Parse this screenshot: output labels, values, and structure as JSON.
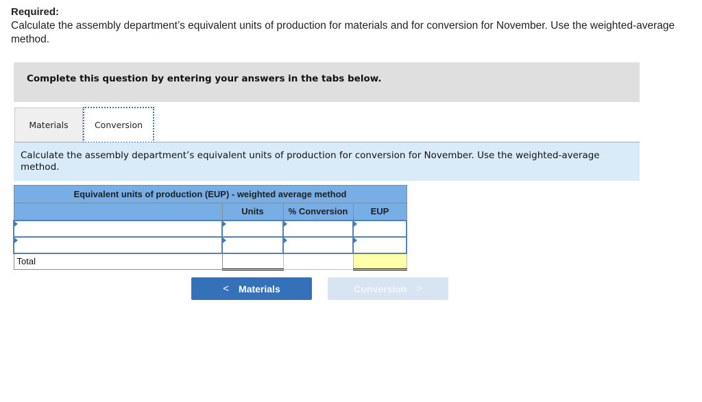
{
  "required": {
    "title": "Required:",
    "text": "Calculate the assembly department’s equivalent units of production for materials and for conversion for November. Use the weighted-average method."
  },
  "banner": {
    "text": "Complete this question by entering your answers in the tabs below."
  },
  "tabs": [
    {
      "label": "Materials",
      "active": false
    },
    {
      "label": "Conversion",
      "active": true
    }
  ],
  "instruction": {
    "text": "Calculate the assembly department’s equivalent units of production for conversion for November. Use the weighted-average method."
  },
  "table": {
    "title": "Equivalent units of production (EUP) - weighted average method",
    "columns": [
      "",
      "Units",
      "% Conversion",
      "EUP"
    ],
    "rows": [
      {
        "label": "",
        "units": "",
        "pct_conversion": "",
        "eup": ""
      },
      {
        "label": "",
        "units": "",
        "pct_conversion": "",
        "eup": ""
      }
    ],
    "total": {
      "label": "Total",
      "units": "",
      "eup": ""
    }
  },
  "nav": {
    "prev_label": "Materials",
    "next_label": "Conversion",
    "prev_icon": "chevron-left-icon",
    "next_icon": "chevron-right-icon"
  },
  "colors": {
    "header_blue": "#77aee6",
    "button_blue": "#3571b9",
    "button_disabled": "#d8e4f2",
    "instruction_bg": "#d9ebf9",
    "banner_bg": "#dfdfdf",
    "total_highlight": "#ffffaa"
  }
}
